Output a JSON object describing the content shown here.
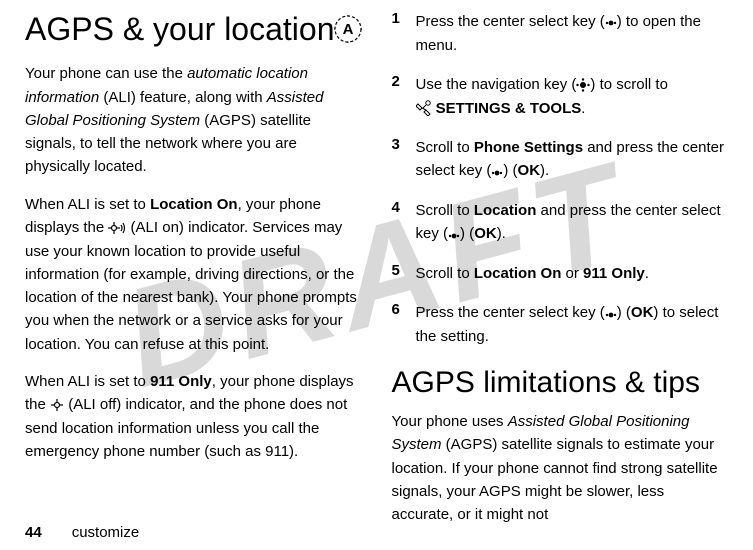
{
  "watermark": "DRAFT",
  "left": {
    "heading": "AGPS & your location",
    "para1_a": "Your phone can use the ",
    "para1_i1": "automatic location information",
    "para1_b": " (ALI) feature, along with ",
    "para1_i2": "Assisted Global Positioning System",
    "para1_c": " (AGPS) satellite signals, to tell the network where you are physically located.",
    "para2_a": "When ALI is set to ",
    "para2_b1": "Location On",
    "para2_b": ", your phone displays the ",
    "para2_c": " (ALI on) indicator. Services may use your known location to provide useful information (for example, driving directions, or the location of the nearest bank). Your phone prompts you when the network or a service asks for your location. You can refuse at this point.",
    "para3_a": "When ALI is set to ",
    "para3_b1": "911 Only",
    "para3_b": ", your phone displays the ",
    "para3_c": " (ALI off) indicator, and the phone does not send location information unless you call the emergency phone number (such as 911)."
  },
  "right": {
    "steps": [
      {
        "num": "1",
        "a": "Press the center select key (",
        "b": ") to open the menu."
      },
      {
        "num": "2",
        "a": "Use the navigation key (",
        "b": ") to scroll to ",
        "c": " SETTINGS & TOOLS",
        "d": "."
      },
      {
        "num": "3",
        "a": "Scroll to ",
        "b1": "Phone Settings",
        "b": " and press the center select key (",
        "c": ") (",
        "c1": "OK",
        "d": ")."
      },
      {
        "num": "4",
        "a": "Scroll to ",
        "b1": "Location",
        "b": " and press the center select key (",
        "c": ") (",
        "c1": "OK",
        "d": ")."
      },
      {
        "num": "5",
        "a": "Scroll to ",
        "b1": "Location On",
        "b": " or ",
        "b2": "911 Only",
        "c": "."
      },
      {
        "num": "6",
        "a": "Press the center select key (",
        "b": ") (",
        "b1": "OK",
        "c": ") to select the setting."
      }
    ],
    "heading2": "AGPS limitations & tips",
    "para4_a": "Your phone uses ",
    "para4_i1": "Assisted Global Positioning System",
    "para4_b": " (AGPS) satellite signals to estimate your location. If your phone cannot find strong satellite signals, your AGPS might be slower, less accurate, or it might not"
  },
  "footer": {
    "page": "44",
    "section": "customize"
  }
}
